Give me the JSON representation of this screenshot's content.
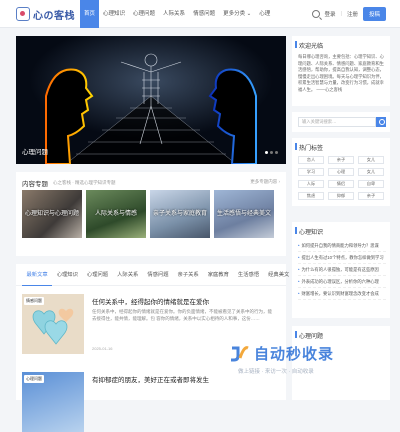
{
  "logo": {
    "text": "心の客栈"
  },
  "nav": [
    "首页",
    "心理知识",
    "心理问题",
    "人际关系",
    "情感问题",
    "更多分类 ⌄",
    "心理"
  ],
  "top": {
    "login": "登录",
    "register": "注册",
    "contribute": "投稿"
  },
  "hero": {
    "caption": "心理问题"
  },
  "topics": {
    "title": "内容专题",
    "subtitle": "心之客栈 · 精选心理学知识专题",
    "more": "更多专题内容 ›",
    "items": [
      "心理知识与心理问题",
      "人际关系与情感",
      "亲子关系与家庭教育",
      "生活感悟与经典美文"
    ]
  },
  "tabs": [
    "最新文章",
    "心理知识",
    "心理问题",
    "人际关系",
    "情感问题",
    "亲子关系",
    "家庭教育",
    "生活感悟",
    "经典美文"
  ],
  "posts": [
    {
      "badge": "情感问题",
      "title": "任何关系中，经得起你的情绪就是在爱你",
      "excerpt": "任何关系中，经得起你的情绪就是在爱你。你的负面情绪，不能被看见了关系中的行为，能去接得住，能共情，能理解。包 容你的情绪，关系中以实心相待的人和事，这份……",
      "date": "2025-01-16"
    },
    {
      "badge": "心理问题",
      "title": "有抑郁症的朋友，美好正在或者即将发生",
      "excerpt": "",
      "date": ""
    }
  ],
  "sidebar": {
    "welcome": {
      "title": "欢迎光临",
      "text": "每日哪心理咨询，主要包括：心理学知识、心理问题、人际关系、情感问题、家庭教育和生活感悟，帮助你，提高自我认知，调整心态，慢慢走出心理困境。每天与心理学知识为伴，积累生活智慧与力量，改变行为习惯，成就幸福人生。 ——心之客栈"
    },
    "search": {
      "placeholder": "输入关键词搜索…"
    },
    "tags": {
      "title": "热门标签",
      "items": [
        "恋人",
        "亲子",
        "女儿",
        "学习",
        "心理",
        "女儿",
        "人际",
        "情侣",
        "自卑",
        "焦虑",
        "抑郁",
        "亲子"
      ]
    },
    "knowledge": {
      "title": "心理知识",
      "items": [
        "如何提升自我的情商能力和领导力？思谋",
        "提出人生有过10个特点，教你怎样做到学习",
        "为什么有的人很孤独，可能是有这些原因",
        "外表成功的心理误区，分析你的六种心理",
        "财富增长，要认识到财富理念改变才会成"
      ]
    },
    "problems": {
      "title": "心理问题"
    }
  },
  "watermark": {
    "text": "自动秒收录",
    "sub": "做上链接 · 来访一次 · 自动收录"
  },
  "colors": {
    "accent": "#4a86e8",
    "hero_bg": "#050a14"
  }
}
